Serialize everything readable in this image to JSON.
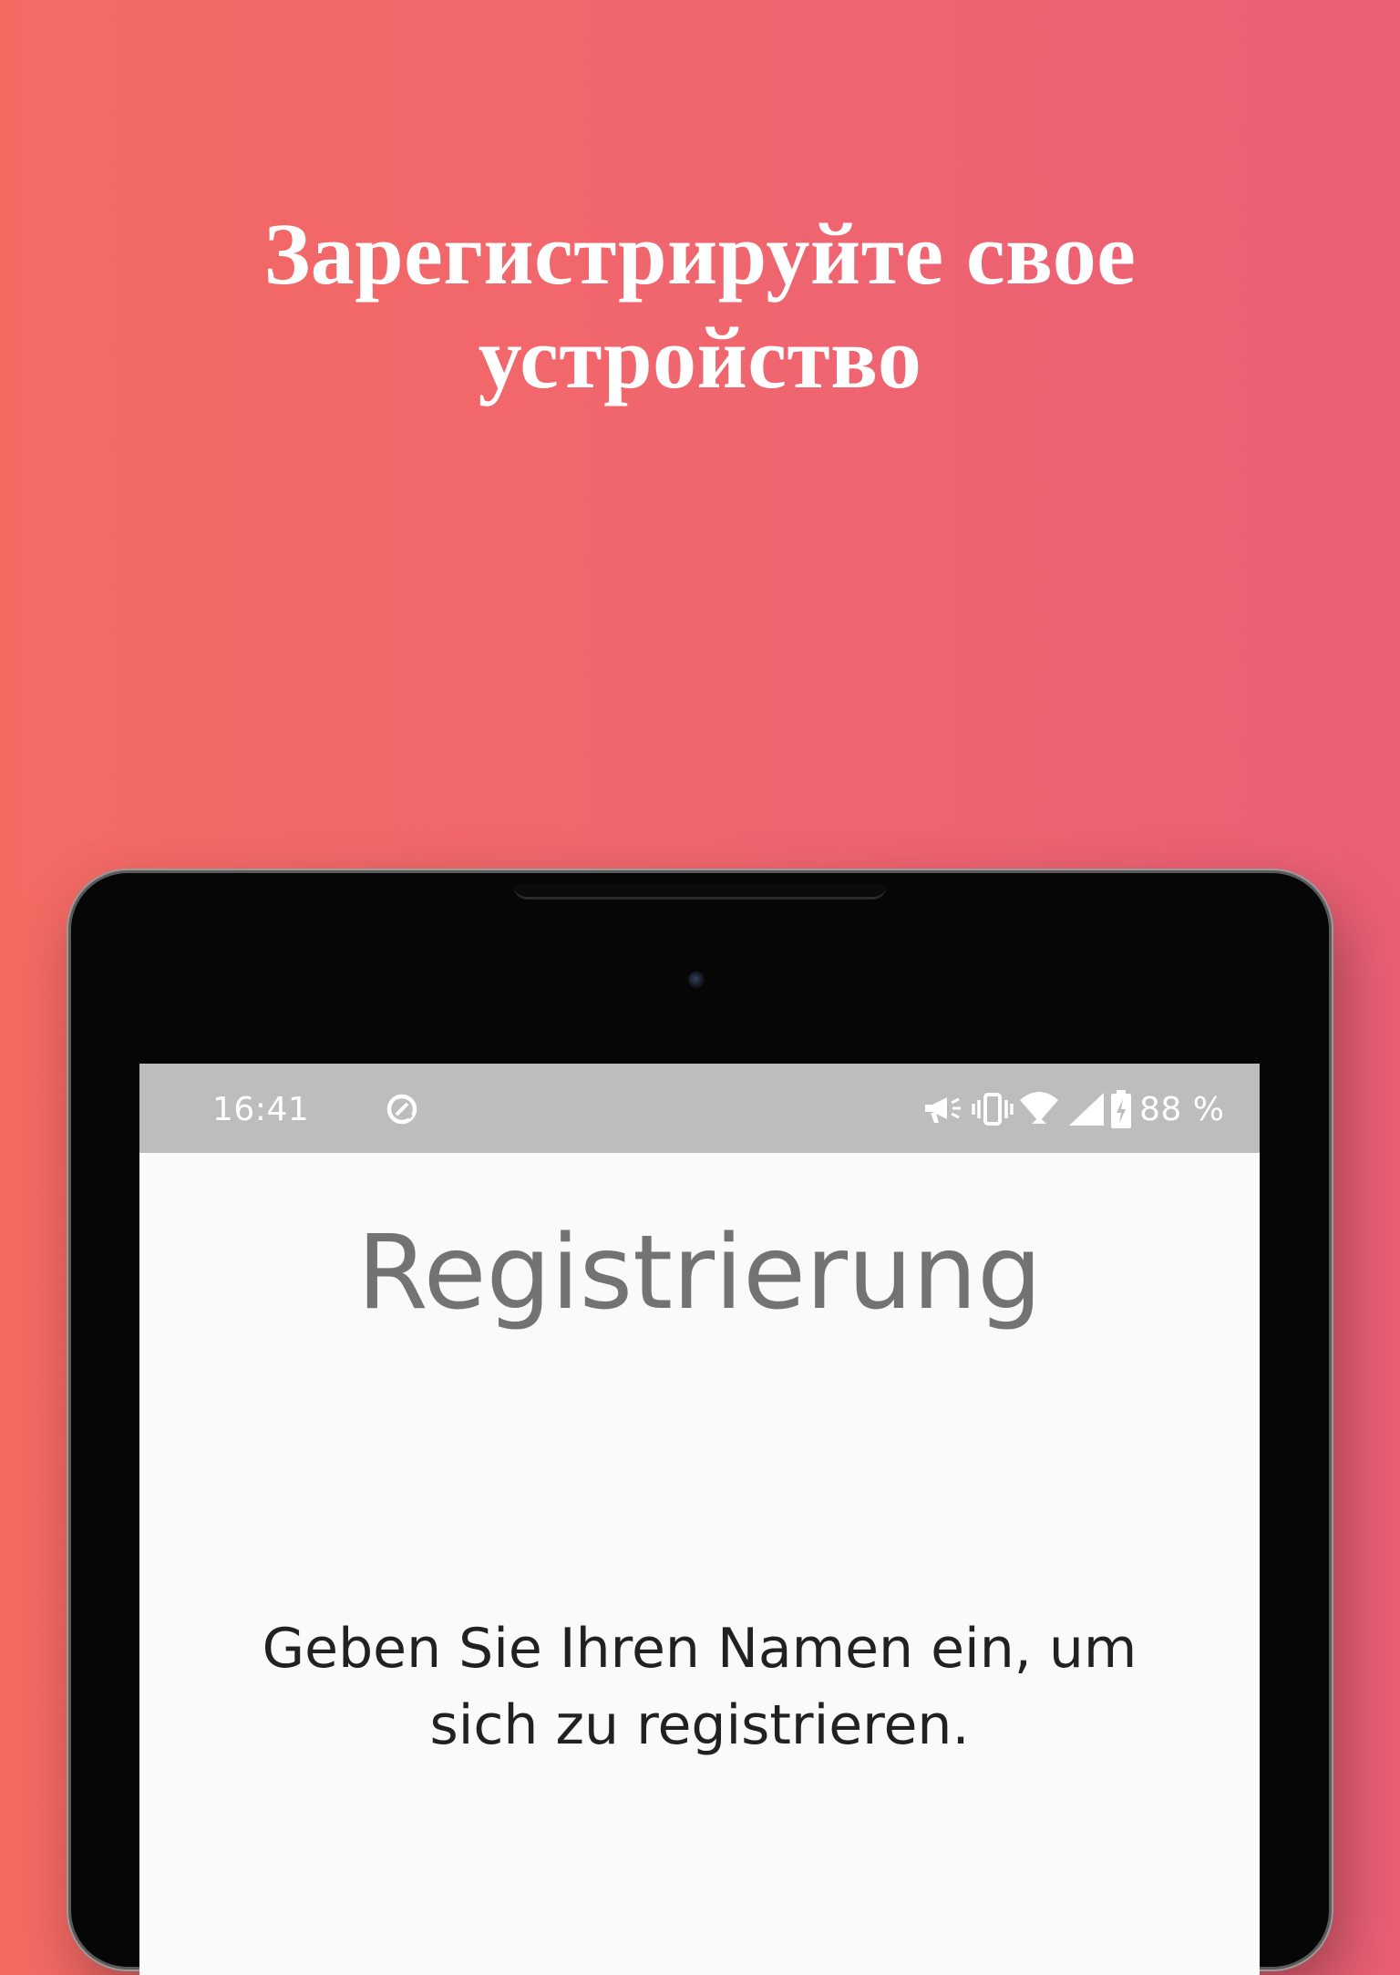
{
  "promo": {
    "headline_line1": "Зарегистрируйте свое",
    "headline_line2": "устройство",
    "background_colors": [
      "#f46a63",
      "#ea5f76"
    ]
  },
  "status_bar": {
    "time": "16:41",
    "battery": "88 %",
    "icons": [
      "data-saver-icon",
      "megaphone-icon",
      "vibrate-icon",
      "wifi-icon",
      "cellular-signal-icon",
      "battery-charging-icon"
    ]
  },
  "app": {
    "title": "Registrierung",
    "instruction": "Geben Sie Ihren Namen ein, um sich zu registrieren."
  }
}
